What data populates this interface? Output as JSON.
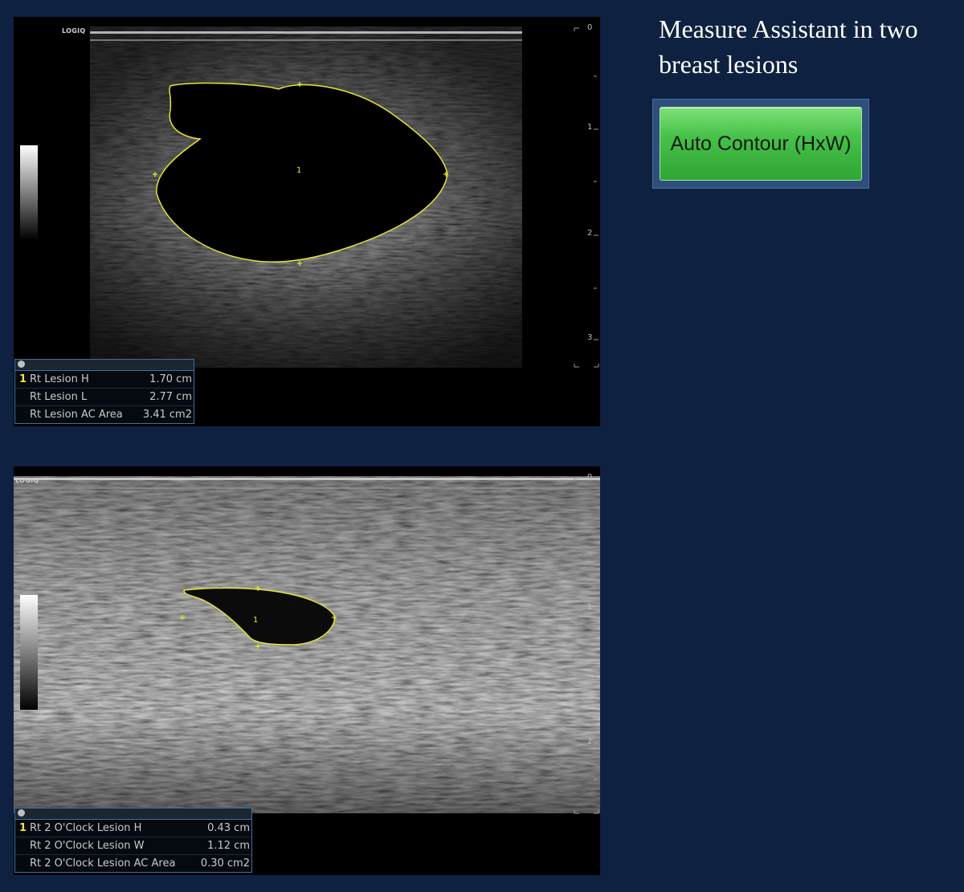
{
  "title": "Measure Assistant in two breast lesions",
  "button": {
    "label": "Auto Contour (HxW)"
  },
  "panels": [
    {
      "logo": "LOGIQ",
      "depth_labels": [
        "0",
        "1",
        "2",
        "3"
      ],
      "marker_label": "1",
      "measurements": [
        {
          "index": "1",
          "label": "Rt Lesion H",
          "value": "1.70 cm"
        },
        {
          "index": "",
          "label": "Rt Lesion L",
          "value": "2.77 cm"
        },
        {
          "index": "",
          "label": "Rt Lesion AC Area",
          "value": "3.41 cm2"
        }
      ]
    },
    {
      "logo": "LOGIQ",
      "depth_labels": [
        "0",
        "1",
        "2"
      ],
      "marker_label": "1",
      "measurements": [
        {
          "index": "1",
          "label": "Rt 2 O'Clock Lesion H",
          "value": "0.43 cm"
        },
        {
          "index": "",
          "label": "Rt 2 O'Clock Lesion W",
          "value": "1.12 cm"
        },
        {
          "index": "",
          "label": "Rt 2 O'Clock Lesion AC Area",
          "value": "0.30 cm2"
        }
      ]
    }
  ],
  "colors": {
    "background": "#0e2140",
    "contour": "#e6e23a",
    "button": "#48c14a",
    "meas_border": "#3e6f9e"
  }
}
